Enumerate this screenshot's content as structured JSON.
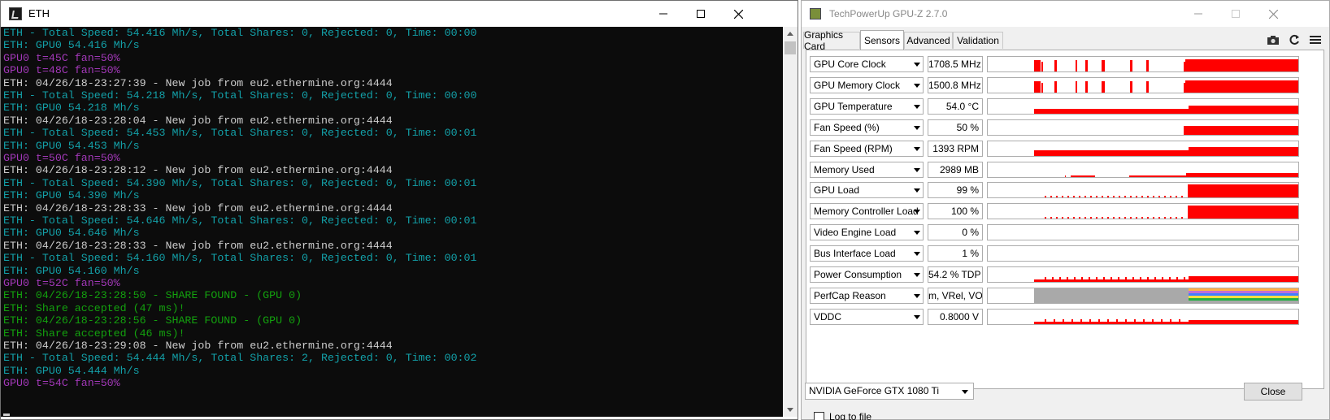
{
  "eth_window": {
    "title": "ETH",
    "lines": [
      {
        "text": "ETH - Total Speed: 54.416 Mh/s, Total Shares: 0, Rejected: 0, Time: 00:00",
        "color": "#13a0a8"
      },
      {
        "text": "ETH: GPU0 54.416 Mh/s",
        "color": "#13a0a8"
      },
      {
        "text": "GPU0 t=45C fan=50%",
        "color": "#a238b8"
      },
      {
        "text": "GPU0 t=48C fan=50%",
        "color": "#a238b8"
      },
      {
        "text": "ETH: 04/26/18-23:27:39 - New job from eu2.ethermine.org:4444",
        "color": "#cccccc"
      },
      {
        "text": "ETH - Total Speed: 54.218 Mh/s, Total Shares: 0, Rejected: 0, Time: 00:00",
        "color": "#13a0a8"
      },
      {
        "text": "ETH: GPU0 54.218 Mh/s",
        "color": "#13a0a8"
      },
      {
        "text": "ETH: 04/26/18-23:28:04 - New job from eu2.ethermine.org:4444",
        "color": "#cccccc"
      },
      {
        "text": "ETH - Total Speed: 54.453 Mh/s, Total Shares: 0, Rejected: 0, Time: 00:01",
        "color": "#13a0a8"
      },
      {
        "text": "ETH: GPU0 54.453 Mh/s",
        "color": "#13a0a8"
      },
      {
        "text": "GPU0 t=50C fan=50%",
        "color": "#a238b8"
      },
      {
        "text": "ETH: 04/26/18-23:28:12 - New job from eu2.ethermine.org:4444",
        "color": "#cccccc"
      },
      {
        "text": "ETH - Total Speed: 54.390 Mh/s, Total Shares: 0, Rejected: 0, Time: 00:01",
        "color": "#13a0a8"
      },
      {
        "text": "ETH: GPU0 54.390 Mh/s",
        "color": "#13a0a8"
      },
      {
        "text": "ETH: 04/26/18-23:28:33 - New job from eu2.ethermine.org:4444",
        "color": "#cccccc"
      },
      {
        "text": "ETH - Total Speed: 54.646 Mh/s, Total Shares: 0, Rejected: 0, Time: 00:01",
        "color": "#13a0a8"
      },
      {
        "text": "ETH: GPU0 54.646 Mh/s",
        "color": "#13a0a8"
      },
      {
        "text": "ETH: 04/26/18-23:28:33 - New job from eu2.ethermine.org:4444",
        "color": "#cccccc"
      },
      {
        "text": "ETH - Total Speed: 54.160 Mh/s, Total Shares: 0, Rejected: 0, Time: 00:01",
        "color": "#13a0a8"
      },
      {
        "text": "ETH: GPU0 54.160 Mh/s",
        "color": "#13a0a8"
      },
      {
        "text": "GPU0 t=52C fan=50%",
        "color": "#a238b8"
      },
      {
        "text": "ETH: 04/26/18-23:28:50 - SHARE FOUND - (GPU 0)",
        "color": "#13a10e"
      },
      {
        "text": "ETH: Share accepted (47 ms)!",
        "color": "#13a10e"
      },
      {
        "text": "ETH: 04/26/18-23:28:56 - SHARE FOUND - (GPU 0)",
        "color": "#13a10e"
      },
      {
        "text": "ETH: Share accepted (46 ms)!",
        "color": "#13a10e"
      },
      {
        "text": "ETH: 04/26/18-23:29:08 - New job from eu2.ethermine.org:4444",
        "color": "#cccccc"
      },
      {
        "text": "ETH - Total Speed: 54.444 Mh/s, Total Shares: 2, Rejected: 0, Time: 00:02",
        "color": "#13a0a8"
      },
      {
        "text": "ETH: GPU0 54.444 Mh/s",
        "color": "#13a0a8"
      },
      {
        "text": "GPU0 t=54C fan=50%",
        "color": "#a238b8"
      }
    ]
  },
  "gpuz_window": {
    "title": "TechPowerUp GPU-Z 2.7.0",
    "tabs": [
      "Graphics Card",
      "Sensors",
      "Advanced",
      "Validation"
    ],
    "active_tab": "Sensors",
    "graph_color": "#ff0000",
    "sensors": [
      {
        "name": "GPU Core Clock",
        "value": "1708.5 MHz"
      },
      {
        "name": "GPU Memory Clock",
        "value": "1500.8 MHz"
      },
      {
        "name": "GPU Temperature",
        "value": "54.0 °C"
      },
      {
        "name": "Fan Speed (%)",
        "value": "50 %"
      },
      {
        "name": "Fan Speed (RPM)",
        "value": "1393 RPM"
      },
      {
        "name": "Memory Used",
        "value": "2989 MB"
      },
      {
        "name": "GPU Load",
        "value": "99 %"
      },
      {
        "name": "Memory Controller Load",
        "value": "100 %"
      },
      {
        "name": "Video Engine Load",
        "value": "0 %"
      },
      {
        "name": "Bus Interface Load",
        "value": "1 %"
      },
      {
        "name": "Power Consumption",
        "value": "54.2 % TDP"
      },
      {
        "name": "PerfCap Reason",
        "value": "m, VRel, VOp"
      },
      {
        "name": "VDDC",
        "value": "0.8000 V"
      }
    ],
    "log_to_file_label": "Log to file",
    "log_to_file_checked": false,
    "gpu_select_value": "NVIDIA GeForce GTX 1080 Ti",
    "close_label": "Close"
  }
}
